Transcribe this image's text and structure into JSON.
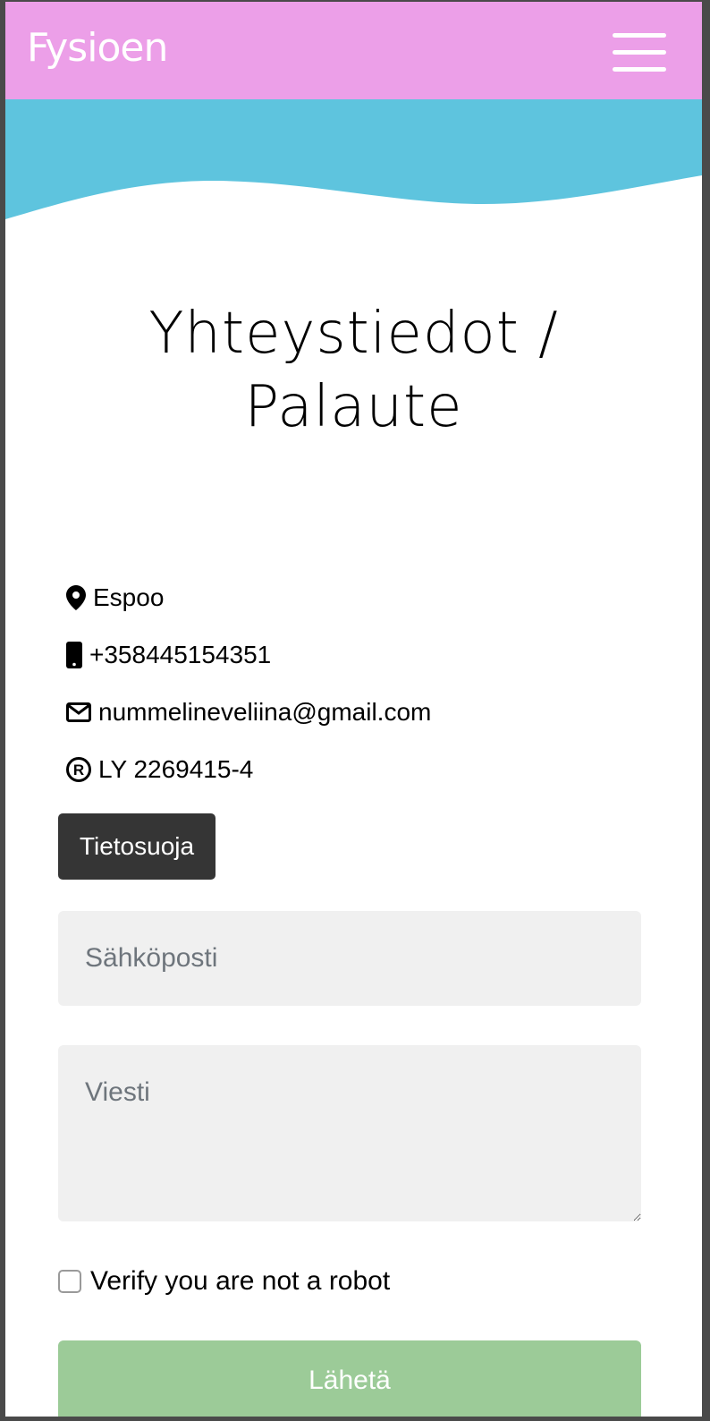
{
  "header": {
    "brand": "Fysioen",
    "menu_icon": "hamburger-menu-icon"
  },
  "colors": {
    "navbar": "#ec9fe8",
    "hero": "#5ec4de",
    "privacy_button": "#353535",
    "submit_button": "#9ccb98",
    "field_background": "#f0f0f0"
  },
  "page": {
    "title_line1": "Yhteystiedot /",
    "title_line2": "Palaute"
  },
  "contact": {
    "location": {
      "icon": "map-marker-icon",
      "text": "Espoo"
    },
    "phone": {
      "icon": "mobile-phone-icon",
      "text": "+358445154351"
    },
    "email": {
      "icon": "envelope-icon",
      "text": "nummelineveliina@gmail.com"
    },
    "business_id": {
      "icon": "registered-icon",
      "text": "LY 2269415-4"
    }
  },
  "privacy_button": "Tietosuoja",
  "form": {
    "email_placeholder": "Sähköposti",
    "email_value": "",
    "message_placeholder": "Viesti",
    "message_value": "",
    "recaptcha_label": "Verify you are not a robot",
    "submit_label": "Lähetä"
  }
}
